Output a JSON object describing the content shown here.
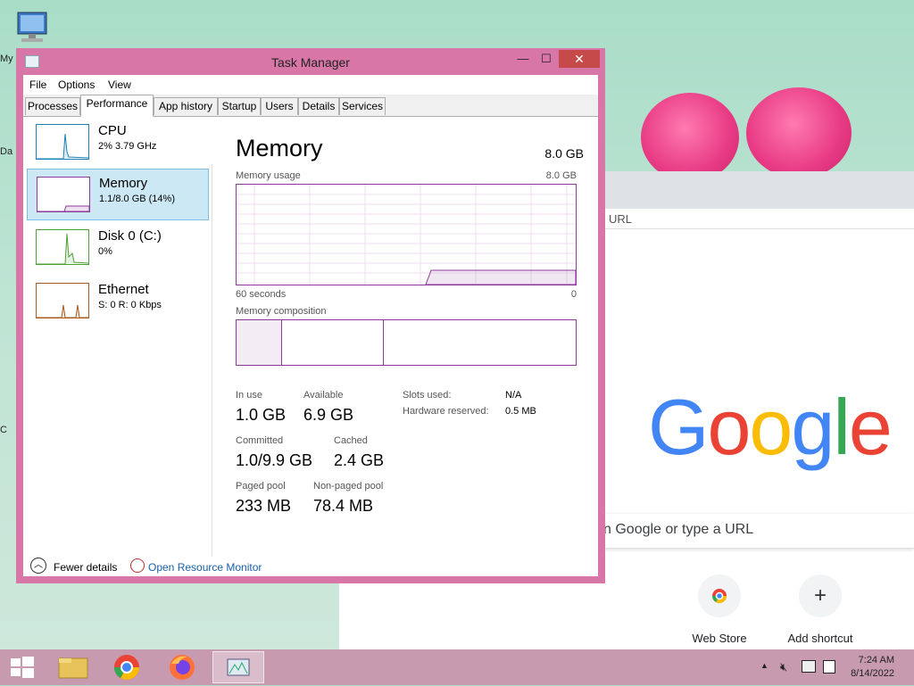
{
  "desktop": {
    "labels": [
      "My",
      "Da",
      "C"
    ]
  },
  "chrome": {
    "omnibox_placeholder": "URL",
    "logo": "Google",
    "search_placeholder": "n Google or type a URL",
    "shortcuts": [
      {
        "label": "Web Store",
        "icon": "web-store-icon"
      },
      {
        "label": "Add shortcut",
        "icon": "plus-icon",
        "glyph": "+"
      }
    ]
  },
  "task_manager": {
    "title": "Task Manager",
    "window_buttons": {
      "minimize": "—",
      "maximize": "☐",
      "close": "✕"
    },
    "menu": [
      "File",
      "Options",
      "View"
    ],
    "tabs": [
      "Processes",
      "Performance",
      "App history",
      "Startup",
      "Users",
      "Details",
      "Services"
    ],
    "active_tab": "Performance",
    "sidebar": [
      {
        "name": "CPU",
        "sub": "2% 3.79 GHz",
        "color": "#1c7fb6"
      },
      {
        "name": "Memory",
        "sub": "1.1/8.0 GB (14%)",
        "color": "#8b3a9a"
      },
      {
        "name": "Disk 0 (C:)",
        "sub": "0%",
        "color": "#4da032"
      },
      {
        "name": "Ethernet",
        "sub": "S: 0 R: 0 Kbps",
        "color": "#a7591e"
      }
    ],
    "memory": {
      "title": "Memory",
      "total": "8.0 GB",
      "usage_label": "Memory usage",
      "usage_max": "8.0 GB",
      "time_left": "60 seconds",
      "time_right": "0",
      "composition_label": "Memory composition",
      "stats": {
        "in_use_label": "In use",
        "in_use": "1.0 GB",
        "available_label": "Available",
        "available": "6.9 GB",
        "committed_label": "Committed",
        "committed": "1.0/9.9 GB",
        "cached_label": "Cached",
        "cached": "2.4 GB",
        "paged_label": "Paged pool",
        "paged": "233 MB",
        "nonpaged_label": "Non-paged pool",
        "nonpaged": "78.4 MB",
        "slots_label": "Slots used:",
        "slots": "N/A",
        "hw_label": "Hardware reserved:",
        "hw": "0.5 MB"
      }
    },
    "footer": {
      "fewer_details": "Fewer details",
      "open_resource_monitor": "Open Resource Monitor"
    }
  },
  "taskbar": {
    "time": "7:24 AM",
    "date": "8/14/2022",
    "pinned": [
      "start-button",
      "file-explorer-icon",
      "chrome-icon",
      "firefox-icon",
      "task-manager-icon"
    ]
  }
}
